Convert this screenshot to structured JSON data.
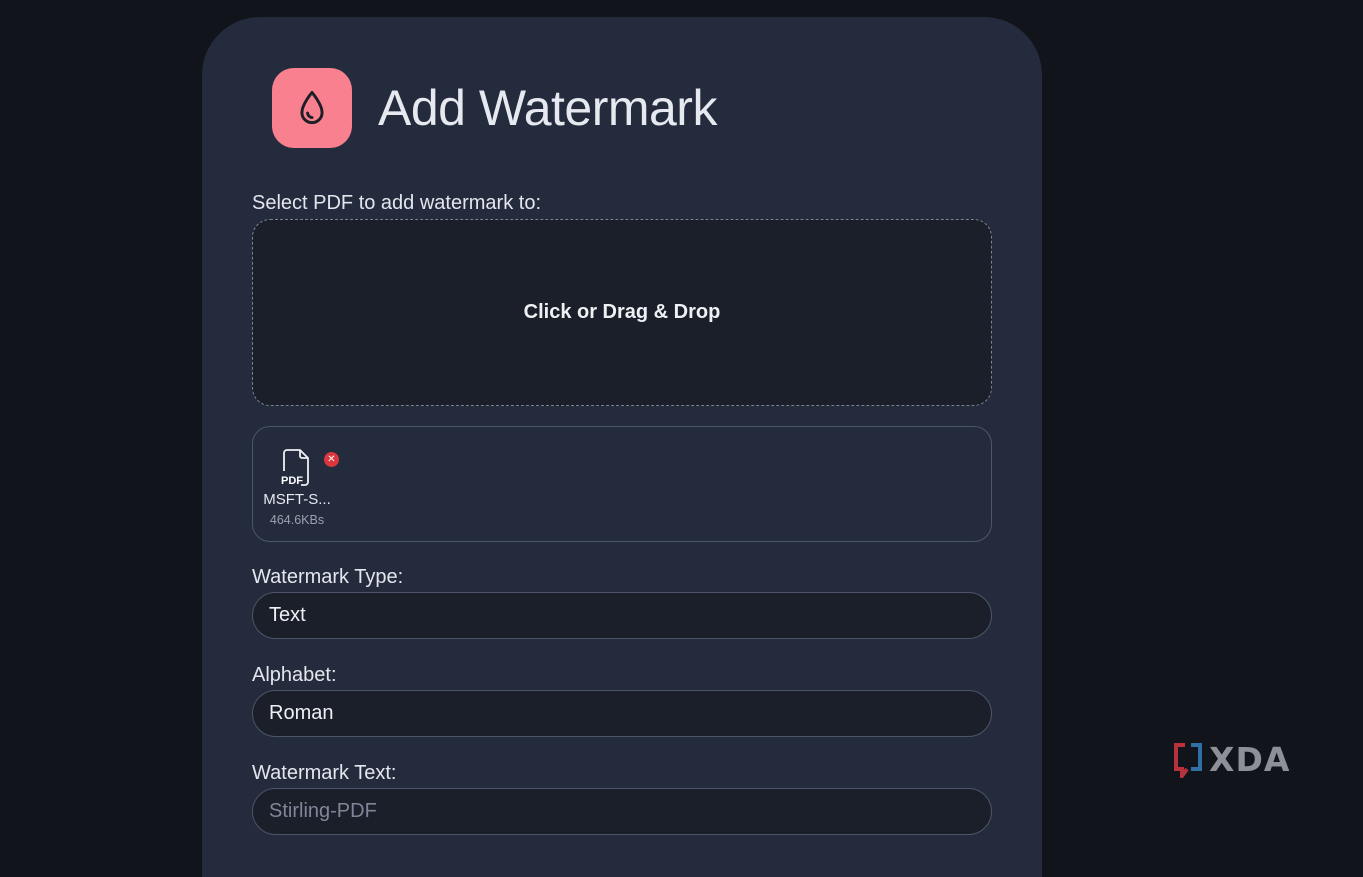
{
  "header": {
    "title": "Add Watermark",
    "icon": "water-drop-icon",
    "icon_bg": "#f8808f"
  },
  "upload": {
    "label": "Select PDF to add watermark to:",
    "dropzone_text": "Click or Drag & Drop"
  },
  "file": {
    "type_tag": "PDF",
    "name": "MSFT-S...",
    "size": "464.6KBs",
    "remove_icon": "close-icon"
  },
  "form": {
    "watermark_type_label": "Watermark Type:",
    "watermark_type_value": "Text",
    "alphabet_label": "Alphabet:",
    "alphabet_value": "Roman",
    "watermark_text_label": "Watermark Text:",
    "watermark_text_placeholder": "Stirling-PDF"
  },
  "branding": {
    "logo_text": "XDA"
  },
  "colors": {
    "page_bg": "#11141a",
    "card_bg": "#242b3c",
    "input_bg": "#1b1f29",
    "accent": "#f8808f",
    "remove_red": "#d9363e"
  }
}
